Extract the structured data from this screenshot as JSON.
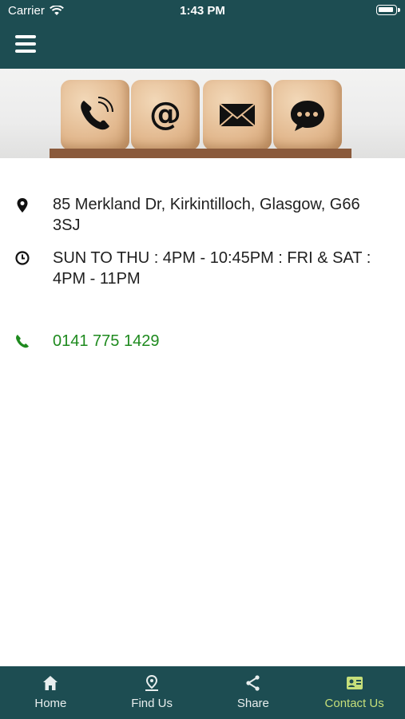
{
  "status_bar": {
    "carrier": "Carrier",
    "time": "1:43 PM"
  },
  "header": {
    "menu_icon": "hamburger-menu-icon"
  },
  "hero": {
    "icons": [
      "phone-icon",
      "at-sign-icon",
      "envelope-icon",
      "chat-bubble-icon"
    ]
  },
  "contact": {
    "address": "85 Merkland Dr, Kirkintilloch, Glasgow, G66 3SJ",
    "hours": "SUN TO THU : 4PM - 10:45PM : FRI & SAT : 4PM - 11PM",
    "phone": "0141 775 1429"
  },
  "tabs": [
    {
      "label": "Home",
      "icon": "home-icon",
      "active": false
    },
    {
      "label": "Find Us",
      "icon": "map-pin-icon",
      "active": false
    },
    {
      "label": "Share",
      "icon": "share-icon",
      "active": false
    },
    {
      "label": "Contact Us",
      "icon": "contact-card-icon",
      "active": true
    }
  ],
  "colors": {
    "header": "#1d4d52",
    "accent_active": "#c6df7a",
    "phone_link": "#1e8a1e"
  }
}
